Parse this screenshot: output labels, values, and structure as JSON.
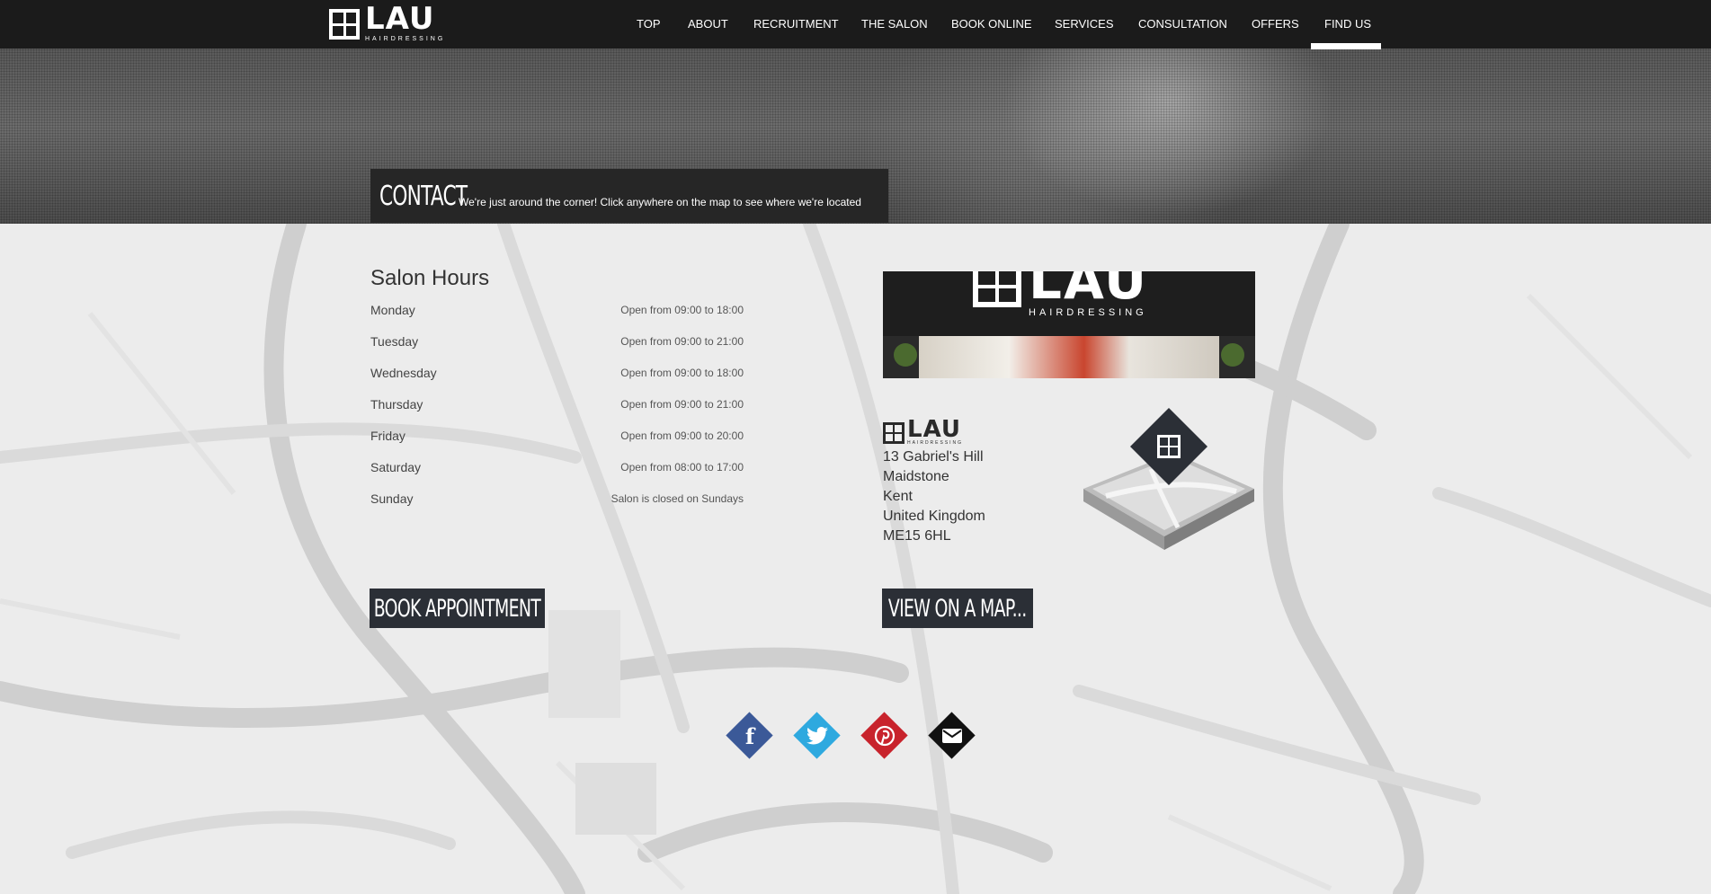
{
  "brand": {
    "wordmark": "LAU",
    "tagline": "HAIRDRESSING"
  },
  "nav": {
    "items": [
      {
        "label": "TOP"
      },
      {
        "label": "ABOUT"
      },
      {
        "label": "RECRUITMENT"
      },
      {
        "label": "THE SALON"
      },
      {
        "label": "BOOK ONLINE"
      },
      {
        "label": "SERVICES"
      },
      {
        "label": "CONSULTATION"
      },
      {
        "label": "OFFERS"
      },
      {
        "label": "FIND US"
      }
    ],
    "active": "FIND US"
  },
  "contact": {
    "title": "CONTACT",
    "subtitle": "We're just around the corner! Click anywhere on the map to see where we're located"
  },
  "hours": {
    "title": "Salon Hours",
    "rows": [
      {
        "day": "Monday",
        "time": "Open from 09:00 to 18:00"
      },
      {
        "day": "Tuesday",
        "time": "Open from 09:00 to 21:00"
      },
      {
        "day": "Wednesday",
        "time": "Open from 09:00 to 18:00"
      },
      {
        "day": "Thursday",
        "time": "Open from 09:00 to 21:00"
      },
      {
        "day": "Friday",
        "time": "Open from 09:00 to 20:00"
      },
      {
        "day": "Saturday",
        "time": "Open from 08:00 to 17:00"
      },
      {
        "day": "Sunday",
        "time": "Salon is closed on Sundays"
      }
    ]
  },
  "buttons": {
    "book": "BOOK APPOINTMENT",
    "map": "VIEW ON A MAP..."
  },
  "address": {
    "lines": [
      "13 Gabriel's Hill",
      "Maidstone",
      "Kent",
      "United Kingdom",
      "ME15 6HL"
    ]
  },
  "social": [
    {
      "name": "facebook",
      "icon": "facebook-icon",
      "glyph": "f",
      "color": "#3b5998"
    },
    {
      "name": "twitter",
      "icon": "twitter-icon",
      "glyph": "t",
      "color": "#2ea9df"
    },
    {
      "name": "pinterest",
      "icon": "pinterest-icon",
      "glyph": "p",
      "color": "#c8232c"
    },
    {
      "name": "email",
      "icon": "mail-icon",
      "glyph": "✉",
      "color": "#111111"
    }
  ],
  "colors": {
    "nav_bg": "#1b1b1b",
    "button_bg": "#2b2f36",
    "map_bg": "#ececec"
  }
}
